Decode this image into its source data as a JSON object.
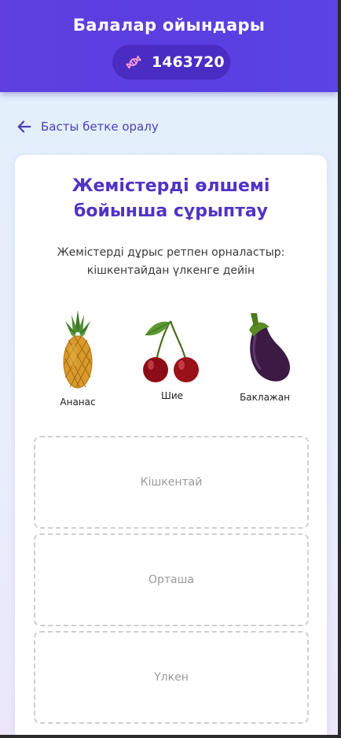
{
  "header": {
    "app_title": "Балалар ойындары",
    "points": "1463720",
    "points_icon": "candy-icon"
  },
  "nav": {
    "back_label": "Басты бетке оралу"
  },
  "game": {
    "title": "Жемістерді өлшемі бойынша сұрыптау",
    "instruction": "Жемістерді дұрыс ретпен орналастыр: кішкентайдан үлкенге дейін",
    "fruits": [
      {
        "label": "Ананас",
        "icon": "pineapple-icon"
      },
      {
        "label": "Шие",
        "icon": "cherry-icon"
      },
      {
        "label": "Баклажан",
        "icon": "eggplant-icon"
      }
    ],
    "drop_zones": [
      {
        "label": "Кішкентай"
      },
      {
        "label": "Орташа"
      },
      {
        "label": "Үлкен"
      }
    ]
  },
  "colors": {
    "header": "#5b3fe0",
    "accent_text": "#5133c4",
    "back_link": "#4b3fb8"
  }
}
